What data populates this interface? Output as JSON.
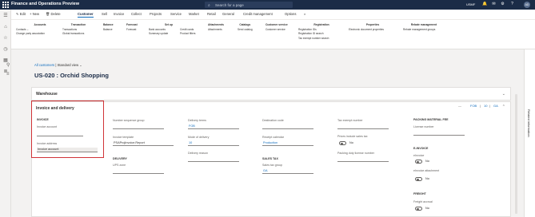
{
  "app": {
    "title": "Finance and Operations Preview",
    "search_placeholder": "Search for a page",
    "company": "USMF",
    "avatar_initials": "AD"
  },
  "tabs": [
    "Edit",
    "New",
    "Delete",
    "Customer",
    "Sell",
    "Invoice",
    "Collect",
    "Projects",
    "Service",
    "Market",
    "Retail",
    "General",
    "Credit management",
    "Options"
  ],
  "groups": [
    {
      "title": "Accounts",
      "items": [
        "Contacts",
        "Change party association"
      ]
    },
    {
      "title": "Transaction",
      "items": [
        "Transactions",
        "Global transactions"
      ]
    },
    {
      "title": "Balance",
      "items": [
        "Balance"
      ]
    },
    {
      "title": "Forecast",
      "items": [
        "Forecast"
      ]
    },
    {
      "title": "Set up",
      "items": [
        "Bank accounts",
        "Summary update"
      ]
    },
    {
      "title": "",
      "items": [
        "Credit cards",
        "Product filters"
      ]
    },
    {
      "title": "Attachments",
      "items": [
        "Attachments"
      ]
    },
    {
      "title": "Catalogs",
      "items": [
        "Send catalog"
      ]
    },
    {
      "title": "Customer service",
      "items": [
        "Customer service"
      ]
    },
    {
      "title": "Registration",
      "items": [
        "Registration IDs",
        "Registration ID search",
        "Tax exempt number search"
      ]
    },
    {
      "title": "Properties",
      "items": [
        "Electronic document properties"
      ]
    },
    {
      "title": "Rebate management",
      "items": [
        "Rebate management groups"
      ]
    }
  ],
  "breadcrumb": {
    "link": "All customers",
    "separator": "|",
    "view": "Standard view"
  },
  "page_title": "US-020 : Orchid Shopping",
  "warehouse": {
    "title": "Warehouse"
  },
  "invoice_section": {
    "title": "Invoice and delivery",
    "summary": [
      "FOB",
      "10",
      "GA"
    ],
    "col1": {
      "heading": "INVOICE",
      "invoice_account_label": "Invoice account",
      "invoice_address_label": "Invoice address",
      "invoice_address_value": "Invoice account"
    },
    "col2": {
      "number_sequence_group_label": "Number sequence group",
      "invoice_template_label": "Invoice template",
      "invoice_template_value": "PSAProjInvoice.Report",
      "delivery_heading": "DELIVERY",
      "ups_zone_label": "UPS zone"
    },
    "col3": {
      "delivery_terms_label": "Delivery terms",
      "delivery_terms_value": "FOB",
      "mode_of_delivery_label": "Mode of delivery",
      "mode_of_delivery_value": "10",
      "delivery_reason_label": "Delivery reason"
    },
    "col4": {
      "destination_code_label": "Destination code",
      "receipt_calendar_label": "Receipt calendar",
      "receipt_calendar_value": "Production",
      "sales_tax_heading": "SALES TAX",
      "sales_tax_group_label": "Sales tax group",
      "sales_tax_group_value": "GA"
    },
    "col5": {
      "tax_exempt_number_label": "Tax exempt number",
      "prices_include_sales_tax_label": "Prices include sales tax",
      "prices_include_sales_tax_value": "No",
      "packing_duty_license_label": "Packing duty license number"
    },
    "col6": {
      "packing_material_fee_heading": "PACKING MATERIAL FEE",
      "license_number_label": "License number",
      "einvoice_heading": "E-INVOICE",
      "einvoice_label": "eInvoice",
      "einvoice_value": "No",
      "einvoice_attachment_label": "eInvoice attachment",
      "einvoice_attachment_value": "No",
      "freight_heading": "FREIGHT",
      "freight_accrual_label": "Freight accrual",
      "freight_accrual_value": "No"
    }
  },
  "related_information": "Related information",
  "colors": {
    "topbar": "#1b2c47",
    "accent": "#0f6cbd",
    "highlight": "#d13438"
  }
}
